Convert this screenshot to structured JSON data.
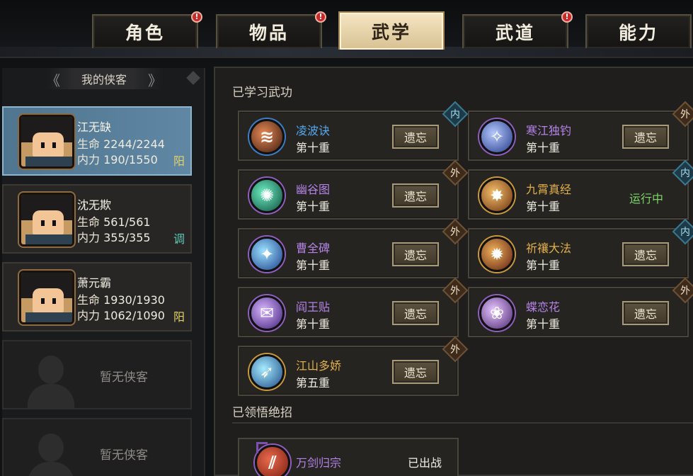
{
  "tabs": [
    {
      "label": "角色",
      "badge": "!"
    },
    {
      "label": "物品",
      "badge": "!"
    },
    {
      "label": "武学",
      "badge": ""
    },
    {
      "label": "武道",
      "badge": "!"
    },
    {
      "label": "能力",
      "badge": ""
    }
  ],
  "active_tab": "武学",
  "roster": {
    "title": "我的侠客",
    "heroes": [
      {
        "name": "江无缺",
        "hp_label": "生命",
        "hp": "2244/2244",
        "mp_label": "内力",
        "mp": "190/1550",
        "tag": "阳",
        "tag_color": "#e3d36a"
      },
      {
        "name": "沈无欺",
        "hp_label": "生命",
        "hp": "561/561",
        "mp_label": "内力",
        "mp": "355/355",
        "tag": "调",
        "tag_color": "#5fc9b8"
      },
      {
        "name": "萧元霸",
        "hp_label": "生命",
        "hp": "1930/1930",
        "mp_label": "内力",
        "mp": "1062/1090",
        "tag": "阳",
        "tag_color": "#e3d36a"
      }
    ],
    "empty_slots": [
      "暂无侠客",
      "暂无侠客"
    ]
  },
  "learned": {
    "title": "已学习武功",
    "forget_label": "遗忘",
    "running_label": "运行中",
    "skills": [
      {
        "name": "凌波诀",
        "level": "第十重",
        "type": "内",
        "name_color": "#54a8ee",
        "icon": "≋",
        "c1": "#e88a55",
        "c2": "#3a1a10",
        "ring": "#3c7fc7",
        "action": "forget"
      },
      {
        "name": "寒江独钓",
        "level": "第十重",
        "type": "外",
        "name_color": "#b583e8",
        "icon": "✧",
        "c1": "#b5c8ff",
        "c2": "#243a86",
        "ring": "#8f5fc0",
        "action": "forget"
      },
      {
        "name": "幽谷图",
        "level": "第十重",
        "type": "外",
        "name_color": "#b583e8",
        "icon": "✺",
        "c1": "#6cf0c0",
        "c2": "#0f4a3e",
        "ring": "#8f5fc0",
        "action": "forget"
      },
      {
        "name": "九霄真经",
        "level": "第十重",
        "type": "内",
        "name_color": "#e2b04a",
        "icon": "✸",
        "c1": "#f5c16a",
        "c2": "#6a2d0e",
        "ring": "#c99a3c",
        "action": "running"
      },
      {
        "name": "曹全碑",
        "level": "第十重",
        "type": "外",
        "name_color": "#b583e8",
        "icon": "✦",
        "c1": "#9be3ff",
        "c2": "#1d3b8a",
        "ring": "#8f5fc0",
        "action": "forget"
      },
      {
        "name": "祈禳大法",
        "level": "第十重",
        "type": "内",
        "name_color": "#e2b04a",
        "icon": "✹",
        "c1": "#f0b35a",
        "c2": "#5e1c10",
        "ring": "#c99a3c",
        "action": "forget"
      },
      {
        "name": "阎王贴",
        "level": "第十重",
        "type": "外",
        "name_color": "#b583e8",
        "icon": "✉",
        "c1": "#d9b6ff",
        "c2": "#3f1e78",
        "ring": "#8f5fc0",
        "action": "forget"
      },
      {
        "name": "蝶恋花",
        "level": "第十重",
        "type": "外",
        "name_color": "#b583e8",
        "icon": "❀",
        "c1": "#e7c6ff",
        "c2": "#4a2470",
        "ring": "#8f5fc0",
        "action": "forget"
      },
      {
        "name": "江山多娇",
        "level": "第五重",
        "type": "外",
        "name_color": "#e2b04a",
        "icon": "➶",
        "c1": "#a6ecff",
        "c2": "#1d4a86",
        "ring": "#c99a3c",
        "action": "forget"
      }
    ]
  },
  "ultimates": {
    "title": "已领悟绝招",
    "items": [
      {
        "name": "万剑归宗",
        "status": "已出战",
        "icon": "⫽"
      }
    ]
  }
}
